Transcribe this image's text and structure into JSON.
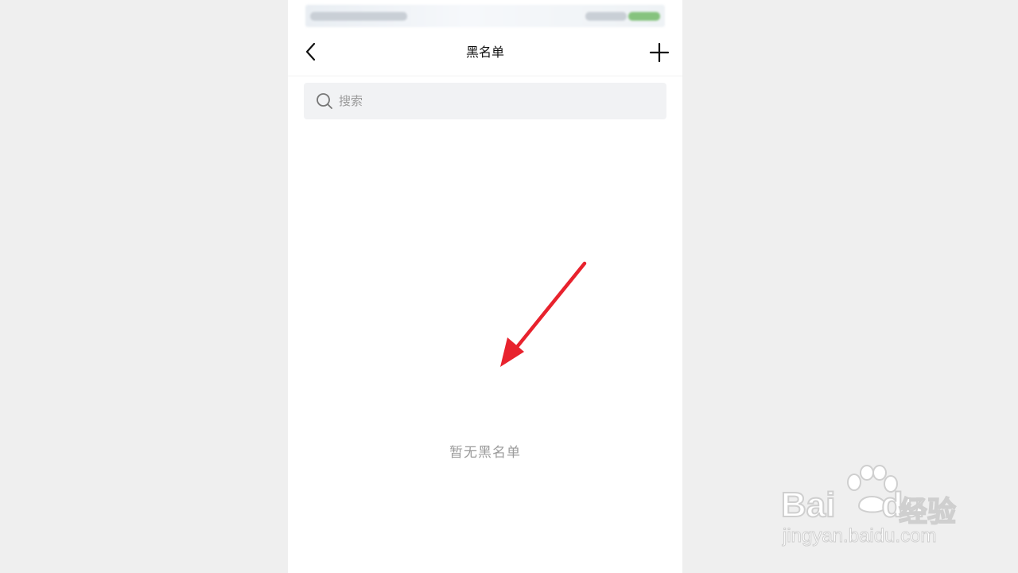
{
  "nav": {
    "title": "黑名单",
    "back_icon": "chevron-left-icon",
    "add_icon": "plus-icon"
  },
  "search": {
    "placeholder": "搜索",
    "value": "",
    "icon": "search-icon"
  },
  "empty_state": {
    "message": "暂无黑名单"
  },
  "annotation": {
    "arrow_color": "#e8222d"
  },
  "watermark": {
    "brand": "Bai",
    "brand_suffix": "du",
    "product": "经验",
    "url": "jingyan.baidu.com"
  },
  "colors": {
    "page_background": "#efefef",
    "screen_background": "#ffffff",
    "search_background": "#f1f2f4"
  }
}
